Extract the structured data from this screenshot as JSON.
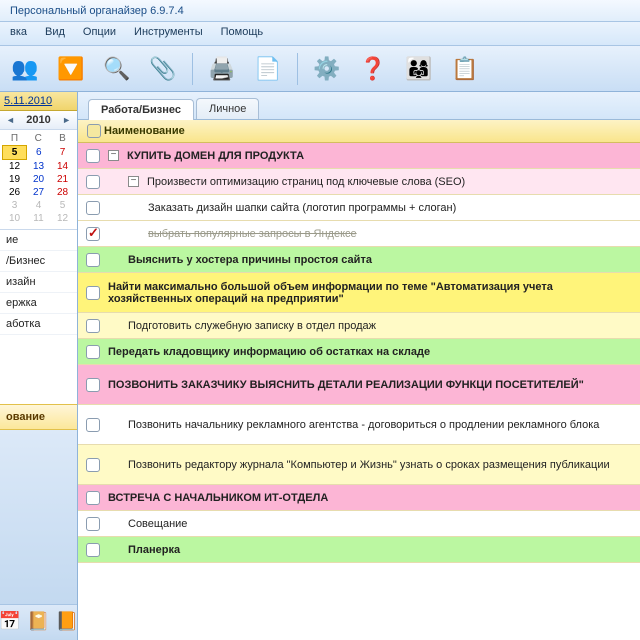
{
  "title": "Персональный органайзер 6.9.7.4",
  "menu": [
    "вка",
    "Вид",
    "Опции",
    "Инструменты",
    "Помощь"
  ],
  "toolbar_icons": [
    {
      "name": "people-icon",
      "emoji": "👥"
    },
    {
      "name": "filter-icon",
      "emoji": "🔽"
    },
    {
      "name": "find-icon",
      "emoji": "🔍"
    },
    {
      "name": "clip-icon",
      "emoji": "📎"
    },
    {
      "name": "sep"
    },
    {
      "name": "print-icon",
      "emoji": "🖨️"
    },
    {
      "name": "preview-icon",
      "emoji": "📄"
    },
    {
      "name": "sep"
    },
    {
      "name": "settings-icon",
      "emoji": "⚙️"
    },
    {
      "name": "help-icon",
      "emoji": "❓"
    },
    {
      "name": "users-icon",
      "emoji": "👨‍👩‍👧"
    },
    {
      "name": "note-icon",
      "emoji": "📋"
    }
  ],
  "sidebar": {
    "date_link": "5.11.2010",
    "month": "2010",
    "dow": [
      "П",
      "С",
      "В"
    ],
    "weeks": [
      [
        "5",
        "6",
        "7"
      ],
      [
        "12",
        "13",
        "14"
      ],
      [
        "19",
        "20",
        "21"
      ],
      [
        "26",
        "27",
        "28"
      ],
      [
        "3",
        "4",
        "5"
      ],
      [
        "10",
        "11",
        "12"
      ]
    ],
    "today_cell": "5",
    "items": [
      "ие",
      "/Бизнес",
      "изайн",
      "ержка",
      "аботка"
    ],
    "folder": "ование",
    "bottom_icons": [
      {
        "name": "calendar-icon",
        "emoji": "📅"
      },
      {
        "name": "tasks-icon",
        "emoji": "📔"
      },
      {
        "name": "contacts-icon",
        "emoji": "📙"
      }
    ]
  },
  "tabs": [
    {
      "label": "Работа/Бизнес",
      "active": true
    },
    {
      "label": "Личное",
      "active": false
    }
  ],
  "header": {
    "col": "Наименование"
  },
  "tasks": [
    {
      "bg": "bg-pink",
      "bold": true,
      "exp": "−",
      "indent": 0,
      "text": "КУПИТЬ ДОМЕН ДЛЯ ПРОДУКТА"
    },
    {
      "bg": "bg-lpink",
      "exp": "−",
      "indent": 1,
      "text": "Произвести оптимизацию страниц под ключевые слова (SEO)"
    },
    {
      "bg": "bg-white",
      "indent": 2,
      "text": "Заказать дизайн шапки сайта (логотип программы + слоган)"
    },
    {
      "bg": "bg-white",
      "checked": true,
      "strike": true,
      "indent": 2,
      "text": "выбрать популярные запросы в Яндексе"
    },
    {
      "bg": "bg-green",
      "bold": true,
      "indent": 1,
      "text": "Выяснить у хостера причины простоя сайта"
    },
    {
      "bg": "bg-yellow",
      "bold": true,
      "indent": 0,
      "multi": true,
      "text": "Найти максимально большой объем информации по теме \"Автоматизация учета хозяйственных операций на предприятии\""
    },
    {
      "bg": "bg-lyellow",
      "indent": 1,
      "text": "Подготовить служебную записку в отдел продаж"
    },
    {
      "bg": "bg-green",
      "bold": true,
      "indent": 0,
      "text": "Передать кладовщику информацию об остатках на складе"
    },
    {
      "bg": "bg-pink",
      "bold": true,
      "indent": 0,
      "multi": true,
      "text": "ПОЗВОНИТЬ ЗАКАЗЧИКУ ВЫЯСНИТЬ ДЕТАЛИ РЕАЛИЗАЦИИ ФУНКЦИ ПОСЕТИТЕЛЕЙ\""
    },
    {
      "bg": "bg-white",
      "indent": 1,
      "multi": true,
      "text": "Позвонить начальнику рекламного агентства - договориться о продлении рекламного блока"
    },
    {
      "bg": "bg-lyellow",
      "indent": 1,
      "multi": true,
      "text": "Позвонить редактору журнала \"Компьютер и Жизнь\" узнать о сроках размещения публикации"
    },
    {
      "bg": "bg-pink",
      "bold": true,
      "indent": 0,
      "text": "ВСТРЕЧА С НАЧАЛЬНИКОМ ИТ-ОТДЕЛА"
    },
    {
      "bg": "bg-white",
      "indent": 1,
      "text": "Совещание"
    },
    {
      "bg": "bg-green",
      "bold": true,
      "indent": 1,
      "text": "Планерка"
    }
  ]
}
